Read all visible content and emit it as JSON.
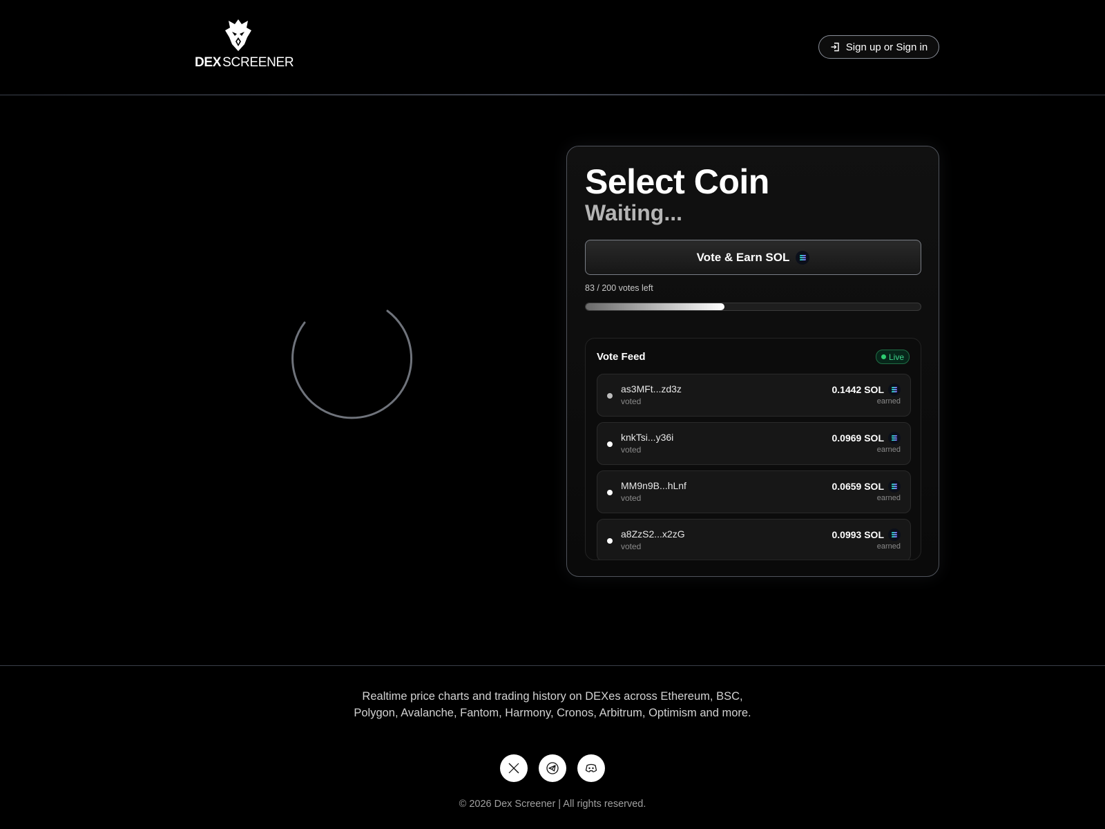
{
  "header": {
    "logo": {
      "brand_bold": "DEX",
      "brand_light": "SCREENER"
    },
    "signin_label": "Sign up or Sign in"
  },
  "card": {
    "title": "Select Coin",
    "status": "Waiting...",
    "vote_button_label": "Vote & Earn SOL",
    "votes_left_text": "83 / 200 votes left",
    "votes_remaining": 83,
    "votes_total": 200,
    "progress_fraction": 0.415
  },
  "feed": {
    "title": "Vote Feed",
    "live_label": "Live",
    "rows": [
      {
        "address": "as3MFt...zd3z",
        "action": "voted",
        "amount": "0.1442 SOL",
        "earned_label": "earned"
      },
      {
        "address": "knkTsi...y36i",
        "action": "voted",
        "amount": "0.0969 SOL",
        "earned_label": "earned"
      },
      {
        "address": "MM9n9B...hLnf",
        "action": "voted",
        "amount": "0.0659 SOL",
        "earned_label": "earned"
      },
      {
        "address": "a8ZzS2...x2zG",
        "action": "voted",
        "amount": "0.0993 SOL",
        "earned_label": "earned"
      }
    ]
  },
  "footer": {
    "tagline": "Realtime price charts and trading history on DEXes across Ethereum, BSC, Polygon, Avalanche, Fantom, Harmony, Cronos, Arbitrum, Optimism and more.",
    "socials": [
      "x-icon",
      "telegram-icon",
      "discord-icon"
    ],
    "copyright": "© 2026 Dex Screener | All rights reserved."
  },
  "colors": {
    "background": "#000000",
    "live_green": "#3ed58c",
    "border": "#50545c"
  }
}
